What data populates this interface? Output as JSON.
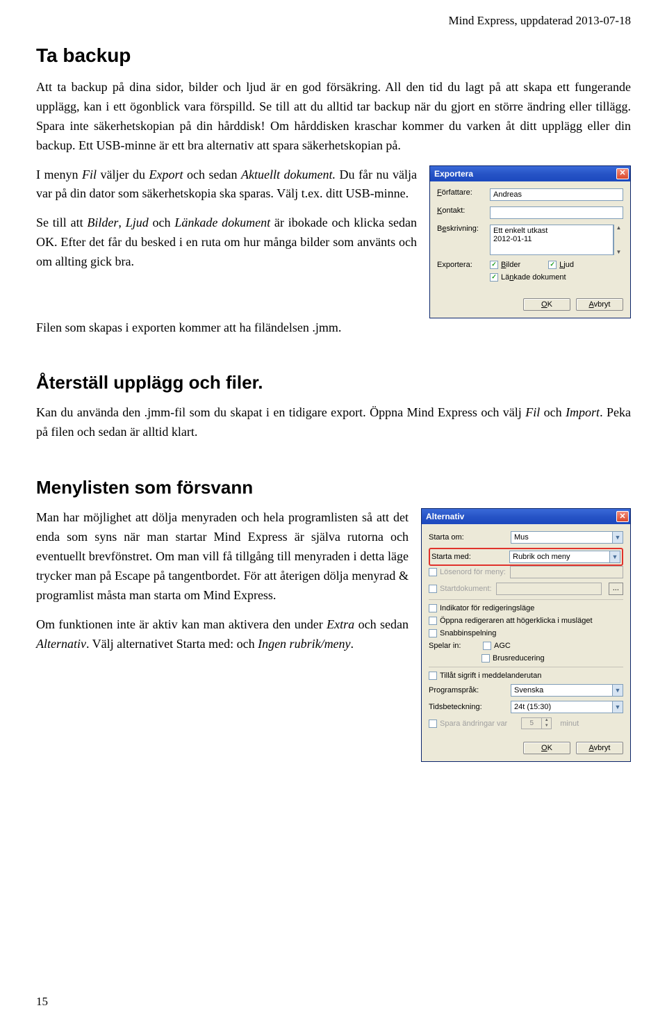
{
  "header_right": "Mind Express, uppdaterad 2013-07-18",
  "h1": "Ta backup",
  "p1_a": "Att ta backup på dina sidor, bilder och ljud är en god försäkring. All den tid du lagt på att skapa ett fungerande upplägg, kan i ett ögonblick vara förspilld. Se till att du alltid tar backup när du gjort en större ändring eller tillägg. Spara inte säkerhetskopian på din hårddisk! Om hårddisken kraschar kommer du varken åt ditt upplägg eller din backup. Ett USB-minne är ett bra alternativ att spara säkerhetskopian på.",
  "p2_prefix": "I menyn ",
  "p2_it1": "Fil",
  "p2_mid": " väljer du ",
  "p2_it2": "Export",
  "p2_mid2": " och sedan ",
  "p2_it3": "Aktuellt dokument.",
  "p2_tail": " Du får nu välja var på din dator som säkerhetskopia ska sparas. Välj t.ex. ditt USB-minne.",
  "p3_prefix": "Se till att ",
  "p3_it1": "Bilder",
  "p3_sep1": ", ",
  "p3_it2": "Ljud",
  "p3_sep2": " och ",
  "p3_it3": "Länkade dokument",
  "p3_tail": " är ibokade och klicka sedan OK. Efter det får du besked i en ruta om hur många bilder som använts och om allting gick bra.",
  "p4": "Filen som skapas i exporten kommer att ha filändelsen .jmm.",
  "h2a": "Återställ upplägg och filer.",
  "p5_prefix": "Kan du använda den .jmm-fil som du skapat i en tidigare export. Öppna Mind Express och välj ",
  "p5_it1": "Fil",
  "p5_mid": " och ",
  "p5_it2": "Import",
  "p5_tail": ". Peka på filen och sedan är alltid klart.",
  "h2b": "Menylisten som försvann",
  "p6": "Man har möjlighet att dölja menyraden och hela programlisten så att det enda som syns när man startar Mind Express är själva rutorna och eventuellt brevfönstret. Om man vill få tillgång till menyraden i detta läge trycker man på Escape på tangentbordet. För att återigen dölja menyrad & programlist måsta man starta om Mind Express.",
  "p7_prefix": "Om funktionen inte är aktiv kan man aktivera den under ",
  "p7_it1": "Extra",
  "p7_mid": " och sedan ",
  "p7_it2": "Alternativ",
  "p7_tail1": ". Välj alternativet Starta med: och ",
  "p7_it3": "Ingen rubrik/meny",
  "p7_tail2": ".",
  "page_num": "15",
  "dlg1": {
    "title": "Exportera",
    "lbl_author": "Författare:",
    "val_author": "Andreas",
    "lbl_contact": "Kontakt:",
    "val_contact": "",
    "lbl_desc": "Beskrivning:",
    "val_desc": "Ett enkelt utkast\n2012-01-11",
    "lbl_export": "Exportera:",
    "chk_bilder": "Bilder",
    "chk_ljud": "Ljud",
    "chk_lankade": "Länkade dokument",
    "btn_ok_u": "O",
    "btn_ok_rest": "K",
    "btn_cancel_u": "A",
    "btn_cancel_rest": "vbryt"
  },
  "dlg2": {
    "title": "Alternativ",
    "lbl_starta_om": "Starta om:",
    "val_starta_om": "Mus",
    "lbl_starta_med": "Starta med:",
    "val_starta_med": "Rubrik och meny",
    "chk_losen": "Lösenord för meny:",
    "chk_startdok": "Startdokument:",
    "chk_indikator": "Indikator för redigeringsläge",
    "chk_oppna": "Öppna redigeraren att högerklicka i musläget",
    "chk_snabb": "Snabbinspelning",
    "lbl_spelar_in": "Spelar in:",
    "chk_agc": "AGC",
    "chk_brus": "Brusreducering",
    "chk_tillat": "Tillåt sigrift i meddelanderutan",
    "lbl_programsprak": "Programspråk:",
    "val_programsprak": "Svenska",
    "lbl_tidsbeteckning": "Tidsbeteckning:",
    "val_tidsbeteckning": "24t (15:30)",
    "chk_spara": "Spara ändringar var",
    "spinner_val": "5",
    "lbl_minut": "minut",
    "btn_ok_u": "O",
    "btn_ok_rest": "K",
    "btn_cancel_u": "A",
    "btn_cancel_rest": "vbryt"
  }
}
